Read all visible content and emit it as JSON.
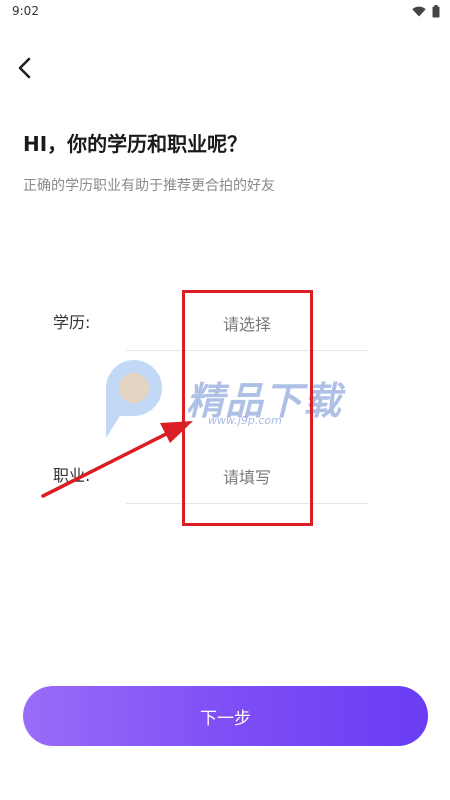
{
  "status_bar": {
    "time": "9:02"
  },
  "header": {
    "back_icon": "chevron-left-icon"
  },
  "title": "HI，你的学历和职业呢？",
  "subtitle": "正确的学历职业有助于推荐更合拍的好友",
  "form": {
    "education": {
      "label": "学历:",
      "value": "请选择"
    },
    "occupation": {
      "label": "职业:",
      "value": "请填写"
    }
  },
  "watermark": {
    "brand": "精品下载",
    "url": "www.j9p.com"
  },
  "next_button": {
    "label": "下一步"
  },
  "colors": {
    "accent_start": "#9b6cf9",
    "accent_end": "#6a3cf3",
    "highlight": "#d91e26"
  }
}
